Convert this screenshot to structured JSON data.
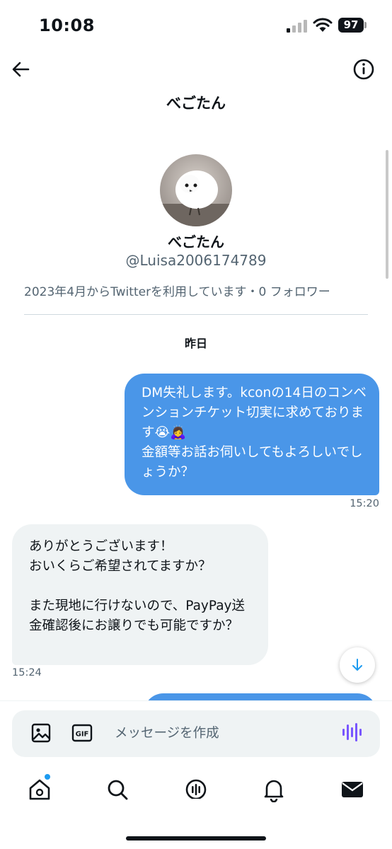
{
  "status_bar": {
    "time": "10:08",
    "battery": "97"
  },
  "header": {
    "title": "べごたん"
  },
  "profile": {
    "name": "べごたん",
    "handle": "@Luisa2006174789",
    "meta": "2023年4月からTwitterを利用しています・0 フォロワー"
  },
  "conversation": {
    "date_separator": "昨日",
    "messages": [
      {
        "direction": "sent",
        "text": "DM失礼します。kconの14日のコンベンションチケット切実に求めております😭🙇‍♀️\n金額等お話お伺いしてもよろしいでしょうか？",
        "time": "15:20"
      },
      {
        "direction": "received",
        "text": "ありがとうございます！\nおいくらご希望されてますか？\n\nまた現地に行けないので、PayPay送金確認後にお譲りでも可能ですか？",
        "time": "15:24"
      }
    ]
  },
  "composer": {
    "placeholder": "メッセージを作成"
  },
  "tabs": [
    "home",
    "search",
    "spaces",
    "notifications",
    "messages"
  ],
  "colors": {
    "accent": "#1d9bf0",
    "sent_bubble": "#4a96e8",
    "received_bubble": "#eff3f4",
    "secondary_text": "#536471",
    "voice": "#7856ff"
  },
  "icons": [
    "back-arrow-icon",
    "info-icon",
    "scroll-down-icon",
    "image-icon",
    "gif-icon",
    "voice-icon",
    "home-icon",
    "search-icon",
    "spaces-icon",
    "bell-icon",
    "mail-icon"
  ]
}
